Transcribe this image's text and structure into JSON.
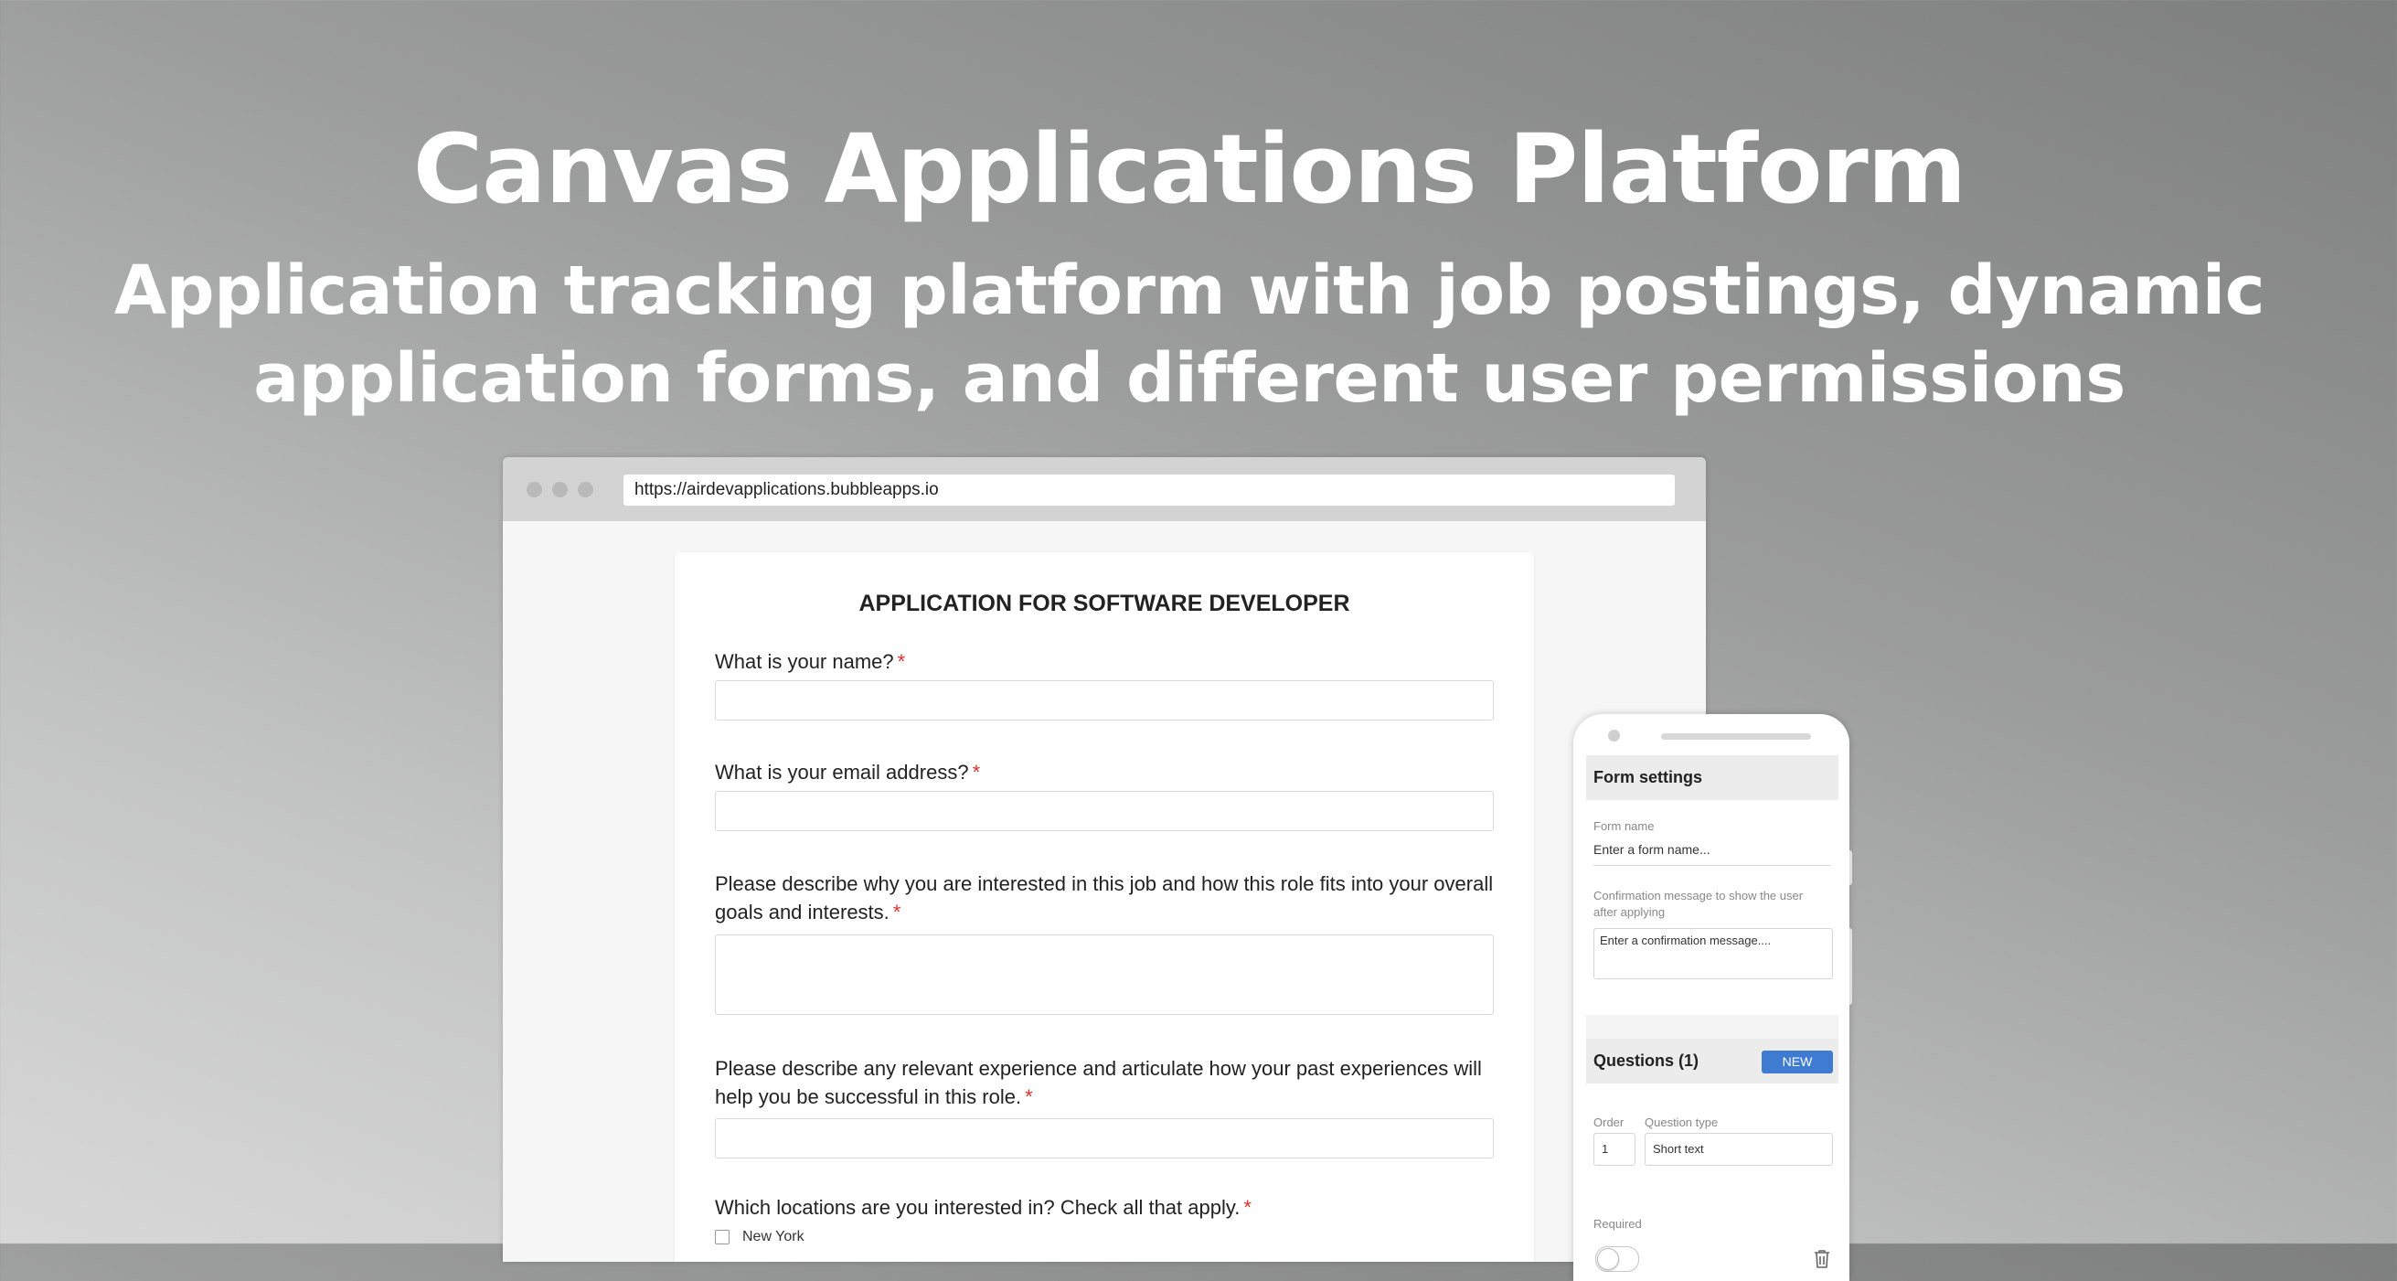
{
  "hero": {
    "title": "Canvas Applications Platform",
    "subtitle_line1": "Application tracking platform with job postings, dynamic",
    "subtitle_line2": "application forms, and different user permissions"
  },
  "browser": {
    "url": "https://airdevapplications.bubbleapps.io"
  },
  "form": {
    "title": "APPLICATION FOR SOFTWARE DEVELOPER",
    "required_marker": "*",
    "questions": [
      {
        "label": "What is your name?"
      },
      {
        "label": "What is your email address?"
      },
      {
        "label_line1": "Please describe why you are interested in this job and how this role fits into your overall",
        "label_line2": "goals and interests."
      },
      {
        "label_line1": "Please describe any relevant experience and articulate how your past experiences will",
        "label_line2": "help you be successful in this role."
      },
      {
        "label": "Which locations are you interested in? Check all that apply."
      }
    ],
    "location_options": [
      "New York"
    ]
  },
  "phone": {
    "form_settings": {
      "heading": "Form settings",
      "form_name_label": "Form name",
      "form_name_placeholder": "Enter a form name...",
      "confirmation_label_line1": "Confirmation message to show the user",
      "confirmation_label_line2": "after applying",
      "confirmation_placeholder": "Enter a confirmation message...."
    },
    "questions": {
      "heading": "Questions (1)",
      "new_button": "NEW",
      "order_label": "Order",
      "order_value": "1",
      "type_label": "Question type",
      "type_value": "Short text",
      "required_label": "Required"
    }
  },
  "colors": {
    "accent": "#3e7bd1",
    "required": "#d9322f"
  }
}
